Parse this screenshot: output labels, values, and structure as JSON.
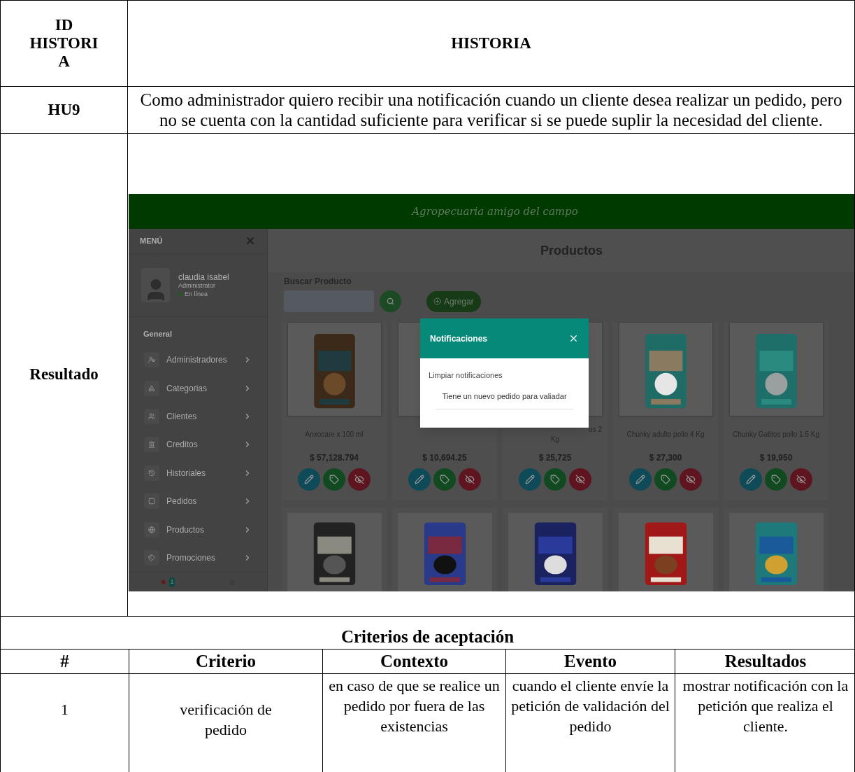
{
  "document": {
    "id_header": "ID HISTORIA",
    "story_header": "HISTORIA",
    "id": "HU9",
    "story": "Como administrador quiero recibir una notificación cuando un cliente desea realizar un pedido, pero no se cuenta con la cantidad suficiente para verificar si se puede suplir la necesidad del cliente.",
    "result_label": "Resultado"
  },
  "app": {
    "brand": "Agropecuaria amigo del campo",
    "menu": {
      "title": "MENÚ",
      "user_name": "claudia isabel",
      "user_role": "Administrator",
      "status": "En línea",
      "section": "General",
      "items": [
        "Administradores",
        "Categorias",
        "Clientes",
        "Creditos",
        "Historiales",
        "Pedidos",
        "Productos",
        "Promociones"
      ],
      "notification_count": "1"
    },
    "page_title": "Productos",
    "search_label": "Buscar Producto",
    "add_button": "Agregar",
    "products": [
      {
        "name_lines": [
          "Anxocare x 100 ml"
        ],
        "price": "$ 57,128.794",
        "partial": false
      },
      {
        "price": "$ 10,694.25"
      },
      {
        "name_lines": [
          "os 2",
          "Kg"
        ],
        "price": "$ 25,725",
        "partial": true
      },
      {
        "name_lines": [
          "Chunky adulto pollo 4 Kg"
        ],
        "price": "$ 27,300",
        "partial": false
      },
      {
        "name_lines": [
          "Chunky Gatitos pollo 1.5 Kg"
        ],
        "price": "$ 19,950",
        "partial": false
      }
    ],
    "modal": {
      "title": "Notificaciones",
      "clear": "Limpiar notificaciones",
      "items": [
        "Tiene un nuevo pedido para valiadar"
      ]
    }
  },
  "criteria": {
    "title": "Criterios de aceptación",
    "columns": [
      "#",
      "Criterio",
      "Contexto",
      "Evento",
      "Resultados"
    ],
    "rows": [
      [
        "1",
        "verificación de pedido",
        "en caso de que se realice un pedido por fuera de las existencias",
        "cuando el cliente envíe la petición de validación del pedido",
        "mostrar notificación con la petición que realiza el cliente."
      ]
    ]
  }
}
